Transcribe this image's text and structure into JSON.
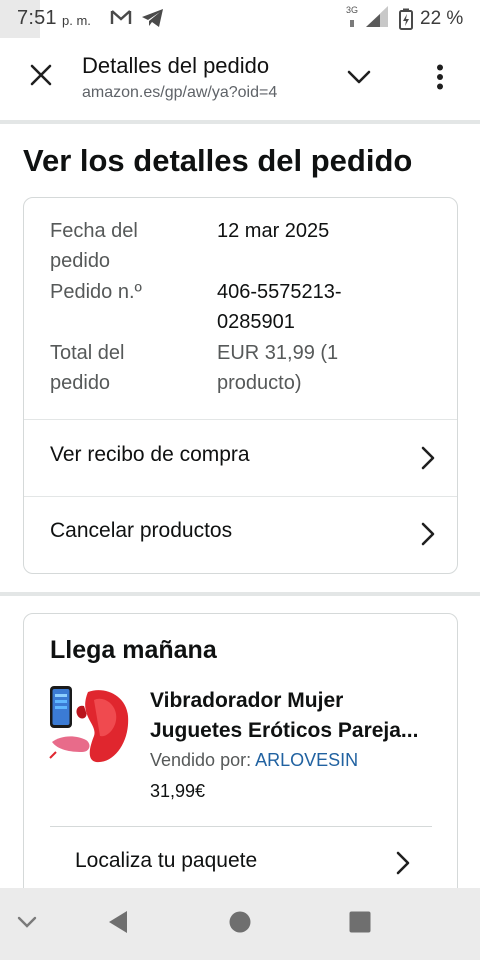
{
  "status_bar": {
    "time": "7:51",
    "ampm": "p. m.",
    "network": "3G",
    "battery": "22 %"
  },
  "browser": {
    "title": "Detalles del pedido",
    "url": "amazon.es/gp/aw/ya?oid=4"
  },
  "page": {
    "heading": "Ver los detalles del pedido"
  },
  "order_details": {
    "rows": [
      {
        "label": "Fecha del pedido",
        "value": "12 mar 2025"
      },
      {
        "label": "Pedido n.º",
        "value": "406-5575213-0285901"
      },
      {
        "label": "Total del pedido",
        "value": "EUR 31,99 (1 producto)"
      }
    ],
    "links": [
      {
        "label": "Ver recibo de compra"
      },
      {
        "label": "Cancelar productos"
      }
    ]
  },
  "delivery": {
    "title": "Llega mañana",
    "product": {
      "title_line1": "Vibradorador Mujer",
      "title_line2": "Juguetes Eróticos Pareja...",
      "sold_by_label": "Vendido por:",
      "seller": "ARLOVESIN",
      "price": "31,99€"
    },
    "track_label": "Localiza tu paquete"
  },
  "icons": {
    "gmail": "gmail-icon",
    "telegram": "telegram-icon",
    "signal": "signal-icon",
    "battery": "battery-icon",
    "close": "close-icon",
    "expand": "chevron-down-icon",
    "menu": "more-vert-icon",
    "chevron": "chevron-right-icon"
  },
  "colors": {
    "link": "#2162a1",
    "text": "#0f1111",
    "secondary": "#565959",
    "divider": "#e3e6e6",
    "product_red": "#e0262e"
  }
}
